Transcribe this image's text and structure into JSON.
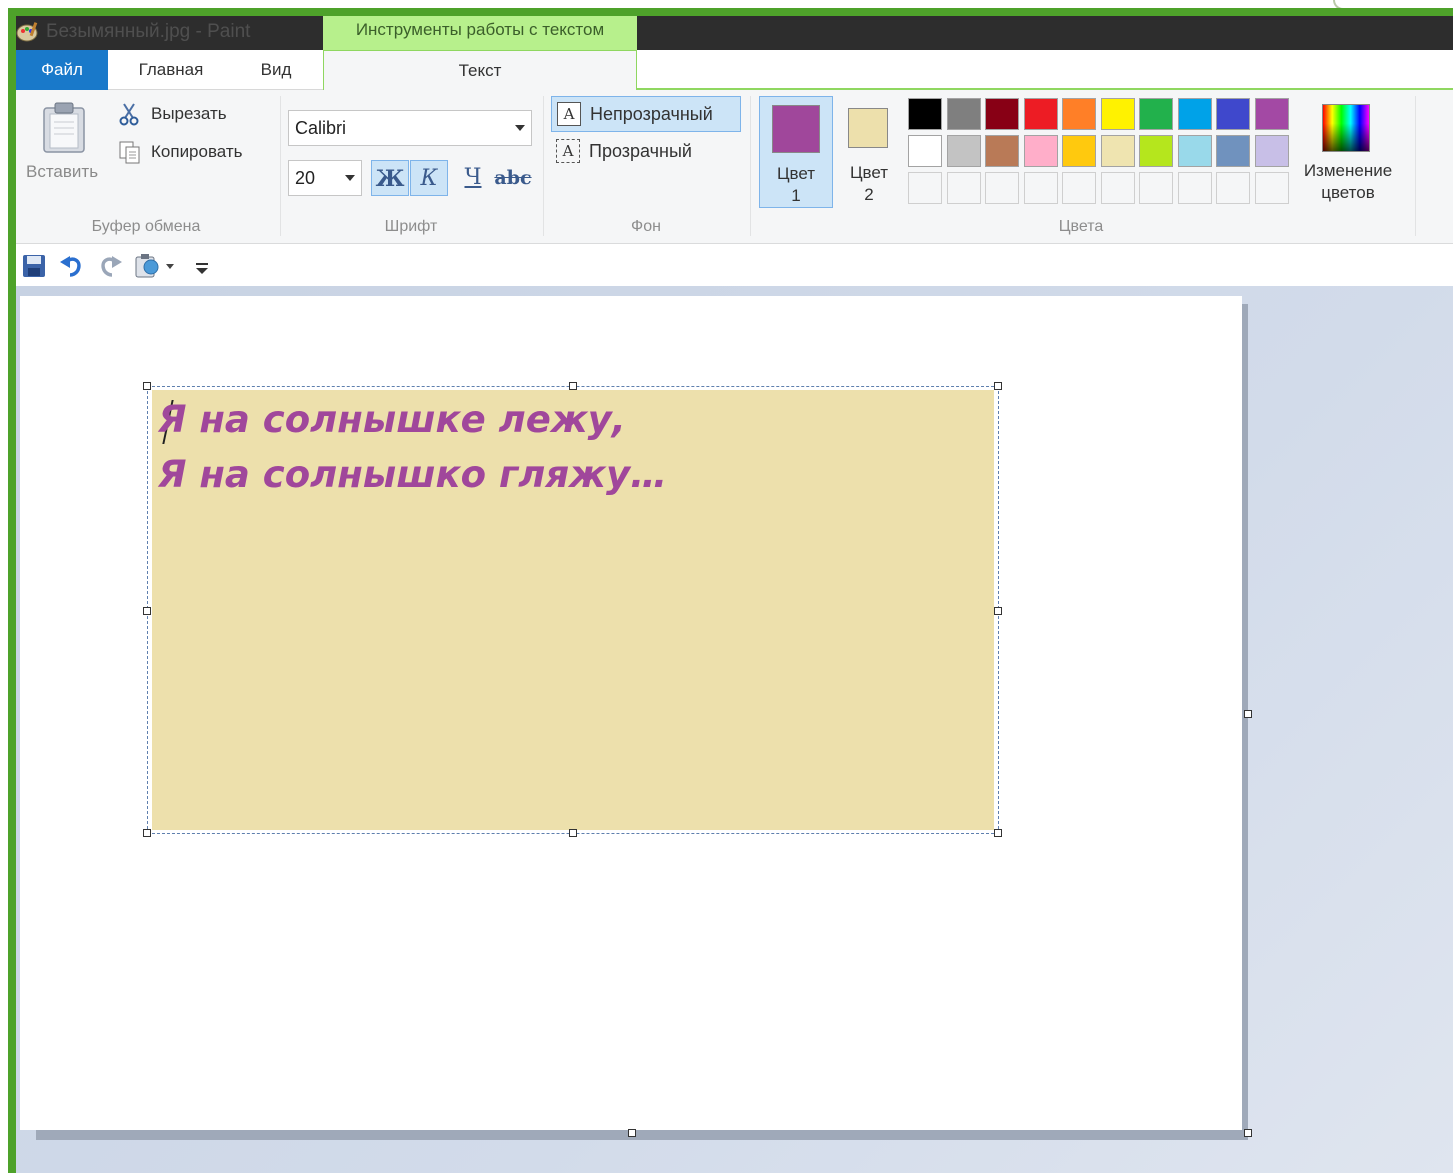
{
  "window": {
    "title": "Безымянный.jpg - Paint",
    "context_tab": "Инструменты работы с текстом"
  },
  "tabs": [
    {
      "label": "Файл"
    },
    {
      "label": "Главная"
    },
    {
      "label": "Вид"
    },
    {
      "label": "Текст"
    }
  ],
  "clipboard": {
    "paste_label": "Вставить",
    "cut_label": "Вырезать",
    "copy_label": "Копировать",
    "group_label": "Буфер обмена"
  },
  "font": {
    "family": "Calibri",
    "size": "20",
    "bold_glyph": "Ж",
    "italic_glyph": "К",
    "underline_glyph": "Ч",
    "strike_glyph": "abc",
    "group_label": "Шрифт"
  },
  "background": {
    "opaque_label": "Непрозрачный",
    "transparent_label": "Прозрачный",
    "icon_glyph": "A",
    "group_label": "Фон"
  },
  "colors": {
    "color1_label_line1": "Цвет",
    "color1_label_line2": "1",
    "color2_label_line1": "Цвет",
    "color2_label_line2": "2",
    "color1": "#a0479b",
    "color2": "#ede0ac",
    "edit_label_line1": "Изменение",
    "edit_label_line2": "цветов",
    "group_label": "Цвета",
    "palette": [
      [
        "#000000",
        "#7f7f7f",
        "#880015",
        "#ed1c24",
        "#ff7f27",
        "#fff200",
        "#22b14c",
        "#00a2e8",
        "#3f48cc",
        "#a349a4"
      ],
      [
        "#ffffff",
        "#c3c3c3",
        "#b97a57",
        "#ffaec9",
        "#ffc90e",
        "#efe4b0",
        "#b5e61d",
        "#99d9ea",
        "#7092be",
        "#c8bfe7"
      ],
      [
        "",
        "",
        "",
        "",
        "",
        "",
        "",
        "",
        "",
        ""
      ]
    ]
  },
  "canvas": {
    "text_lines": [
      "Я на солнышке лежу,",
      "Я на солнышко гляжу…"
    ],
    "text_color": "#a0479b",
    "text_background": "#ede0ac"
  },
  "quick_access": [
    "save-icon",
    "undo-icon",
    "redo-icon",
    "paste-dropdown-icon",
    "customize-icon"
  ]
}
